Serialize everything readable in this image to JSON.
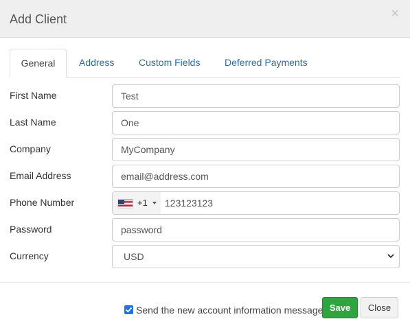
{
  "modal": {
    "title": "Add Client",
    "close_glyph": "×"
  },
  "tabs": [
    {
      "label": "General",
      "active": true
    },
    {
      "label": "Address",
      "active": false
    },
    {
      "label": "Custom Fields",
      "active": false
    },
    {
      "label": "Deferred Payments",
      "active": false
    }
  ],
  "form": {
    "first_name": {
      "label": "First Name",
      "value": "Test"
    },
    "last_name": {
      "label": "Last Name",
      "value": "One"
    },
    "company": {
      "label": "Company",
      "value": "MyCompany"
    },
    "email": {
      "label": "Email Address",
      "value": "email@address.com"
    },
    "phone": {
      "label": "Phone Number",
      "country_icon": "us-flag-icon",
      "dial_code": "+1",
      "value": "123123123"
    },
    "password": {
      "label": "Password",
      "value": "password"
    },
    "currency": {
      "label": "Currency",
      "selected": "USD"
    }
  },
  "footer": {
    "send_message_checked": true,
    "send_message_label": "Send the new account information message",
    "save_label": "Save",
    "close_label": "Close"
  },
  "colors": {
    "header_bg": "#efefef",
    "tab_link": "#2e6da4",
    "save_bg": "#2da640",
    "checkbox": "#1a73e8"
  }
}
